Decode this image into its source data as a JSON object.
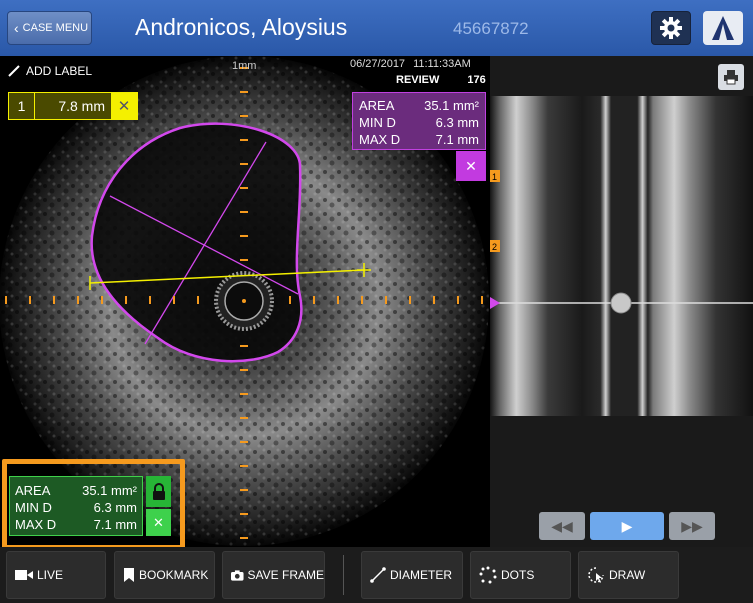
{
  "header": {
    "case_menu_label": "CASE MENU",
    "patient_name": "Andronicos, Aloysius",
    "patient_id": "45667872"
  },
  "overlay": {
    "add_label": "ADD LABEL",
    "scale": "1mm",
    "date": "06/27/2017",
    "time": "11:11:33AM",
    "mode": "REVIEW",
    "frame": "176"
  },
  "diameter_tag": {
    "index": "1",
    "value": "7.8 mm",
    "color": "#f4f000"
  },
  "purple_measure": {
    "area_label": "AREA",
    "area": "35.1 mm²",
    "min_label": "MIN D",
    "min": "6.3 mm",
    "max_label": "MAX D",
    "max": "7.1 mm",
    "color": "#c23ae0"
  },
  "green_measure": {
    "area_label": "AREA",
    "area": "35.1 mm²",
    "min_label": "MIN D",
    "min": "6.3 mm",
    "max_label": "MAX D",
    "max": "7.1 mm",
    "color": "#3ed14c"
  },
  "longitudinal": {
    "markers": [
      "1",
      "2"
    ]
  },
  "toolbar": {
    "live": "LIVE",
    "bookmark": "BOOKMARK",
    "save_frame": "SAVE FRAME",
    "diameter": "DIAMETER",
    "dots": "DOTS",
    "draw": "DRAW"
  },
  "icons": [
    "chevron-left-icon",
    "gear-icon",
    "logo-icon",
    "pencil-icon",
    "print-icon",
    "lock-icon",
    "close-icon",
    "rewind-icon",
    "play-icon",
    "fast-forward-icon",
    "camera-icon",
    "bookmark-icon",
    "video-icon",
    "diameter-icon",
    "dots-icon",
    "draw-icon"
  ]
}
